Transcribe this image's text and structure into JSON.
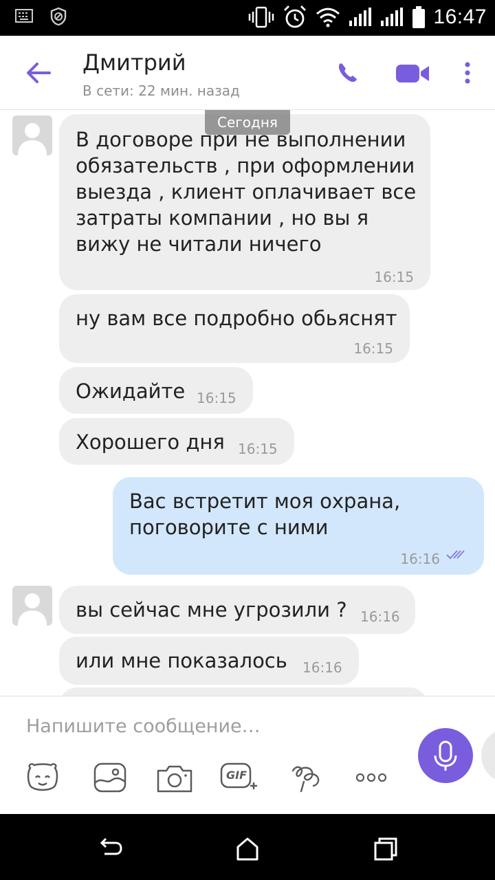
{
  "status_bar": {
    "time": "16:47",
    "icons": [
      "keyboard-icon",
      "blocked-icon",
      "vibrate-icon",
      "alarm-icon",
      "wifi-icon",
      "signal-icon",
      "signal-icon",
      "battery-icon"
    ]
  },
  "header": {
    "contact_name": "Дмитрий",
    "presence": "В сети: 22 мин. назад",
    "icons": [
      "back-arrow-icon",
      "phone-icon",
      "video-camera-icon",
      "more-vertical-icon"
    ],
    "accent_color": "#7a5ddd"
  },
  "chat": {
    "date_separator": "Сегодня",
    "messages": [
      {
        "direction": "in",
        "lines": [
          "В договоре при не выполнении",
          "обязательств , при оформлении",
          "выезда , клиент оплачивает все",
          "затраты компании , но вы я",
          "вижу не читали ничего"
        ],
        "time": "16:15"
      },
      {
        "direction": "in",
        "lines": [
          "ну вам все подробно обьяснят"
        ],
        "time": "16:15"
      },
      {
        "direction": "in",
        "lines": [
          "Ожидайте"
        ],
        "time": "16:15"
      },
      {
        "direction": "in",
        "lines": [
          "Хорошего дня"
        ],
        "time": "16:15"
      },
      {
        "direction": "out",
        "lines": [
          "Вас встретит моя охрана,",
          "поговорите с ними"
        ],
        "time": "16:16"
      },
      {
        "direction": "in",
        "lines": [
          "вы сейчас мне угрозили ?"
        ],
        "time": "16:16"
      },
      {
        "direction": "in",
        "lines": [
          "или мне показалось"
        ],
        "time": "16:16"
      }
    ],
    "incoming_color": "#eeeeee",
    "outgoing_color": "#d2e7fb"
  },
  "composer": {
    "placeholder": "Напишите сообщение…",
    "tools": [
      "sticker-icon",
      "gallery-icon",
      "camera-icon",
      "gif-icon",
      "doodle-icon",
      "more-horizontal-icon"
    ],
    "gif_label": "GIF"
  },
  "nav_bar": {
    "icons": [
      "back-icon",
      "home-icon",
      "recents-icon"
    ]
  }
}
